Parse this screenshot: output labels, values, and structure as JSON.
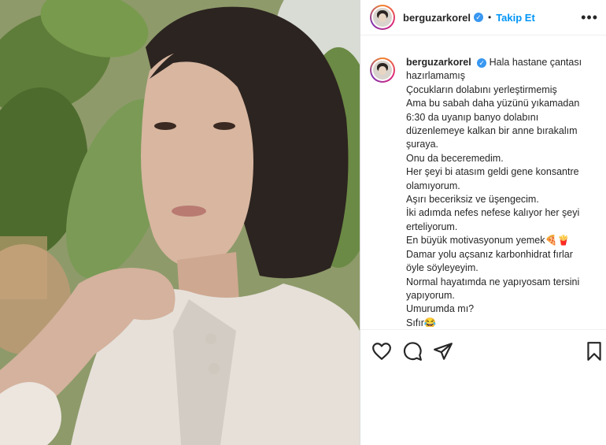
{
  "post": {
    "username": "berguzarkorel",
    "separator": "•",
    "follow_label": "Takip Et",
    "more_label": "•••",
    "verified_icon": "verified-badge-icon",
    "caption_lines": [
      "Hala hastane çantası",
      "hazırlamamış",
      "Çocukların dolabını yerleştirmemiş",
      "Ama bu sabah daha yüzünü yıkamadan",
      "6:30 da uyanıp banyo dolabını",
      "düzenlemeye kalkan bir anne bırakalım",
      "şuraya.",
      "Onu da beceremedim.",
      "Her şeyi bi atasım geldi gene konsantre",
      "olamıyorum.",
      "Aşırı beceriksiz ve üşengecim.",
      "İki adımda nefes nefese kalıyor her şeyi",
      "erteliyorum.",
      "En büyük motivasyonum yemek🍕🍟",
      "Damar yolu açsanız karbonhidrat fırlar",
      "öyle söyleyeyim.",
      "Normal hayatımda ne yapıyosam tersini",
      "yapıyorum.",
      "Umurumda mı?",
      "Sıfır😂"
    ]
  },
  "actions": {
    "icons": [
      "heart-icon",
      "comment-icon",
      "share-icon",
      "bookmark-icon"
    ]
  },
  "colors": {
    "link_blue": "#0095f6",
    "verified_blue": "#3897f0",
    "text": "#262626"
  }
}
